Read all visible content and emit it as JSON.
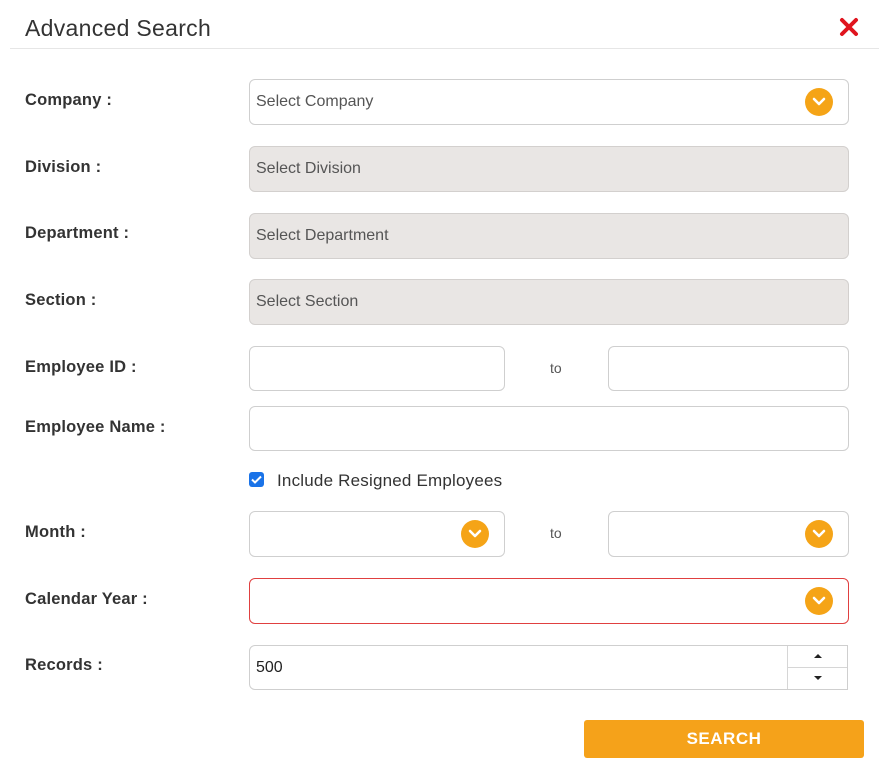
{
  "dialog": {
    "title": "Advanced Search"
  },
  "labels": {
    "company": "Company :",
    "division": "Division :",
    "department": "Department :",
    "section": "Section :",
    "employee_id": "Employee ID :",
    "employee_name": "Employee Name :",
    "month": "Month :",
    "calendar_year": "Calendar Year :",
    "records": "Records :"
  },
  "fields": {
    "company_placeholder": "Select Company",
    "division_placeholder": "Select Division",
    "department_placeholder": "Select Department",
    "section_placeholder": "Select Section",
    "employee_id_from": "",
    "employee_id_to": "",
    "employee_name": "",
    "month_from": "",
    "month_to": "",
    "calendar_year": "",
    "records_value": "500",
    "range_separator": "to"
  },
  "checkbox": {
    "label": "Include Resigned Employees",
    "checked": true
  },
  "buttons": {
    "search_label": "SEARCH"
  },
  "colors": {
    "accent": "#f5a417",
    "close": "#e0141e",
    "checkbox": "#1a73e8",
    "error_border": "#e04040"
  }
}
